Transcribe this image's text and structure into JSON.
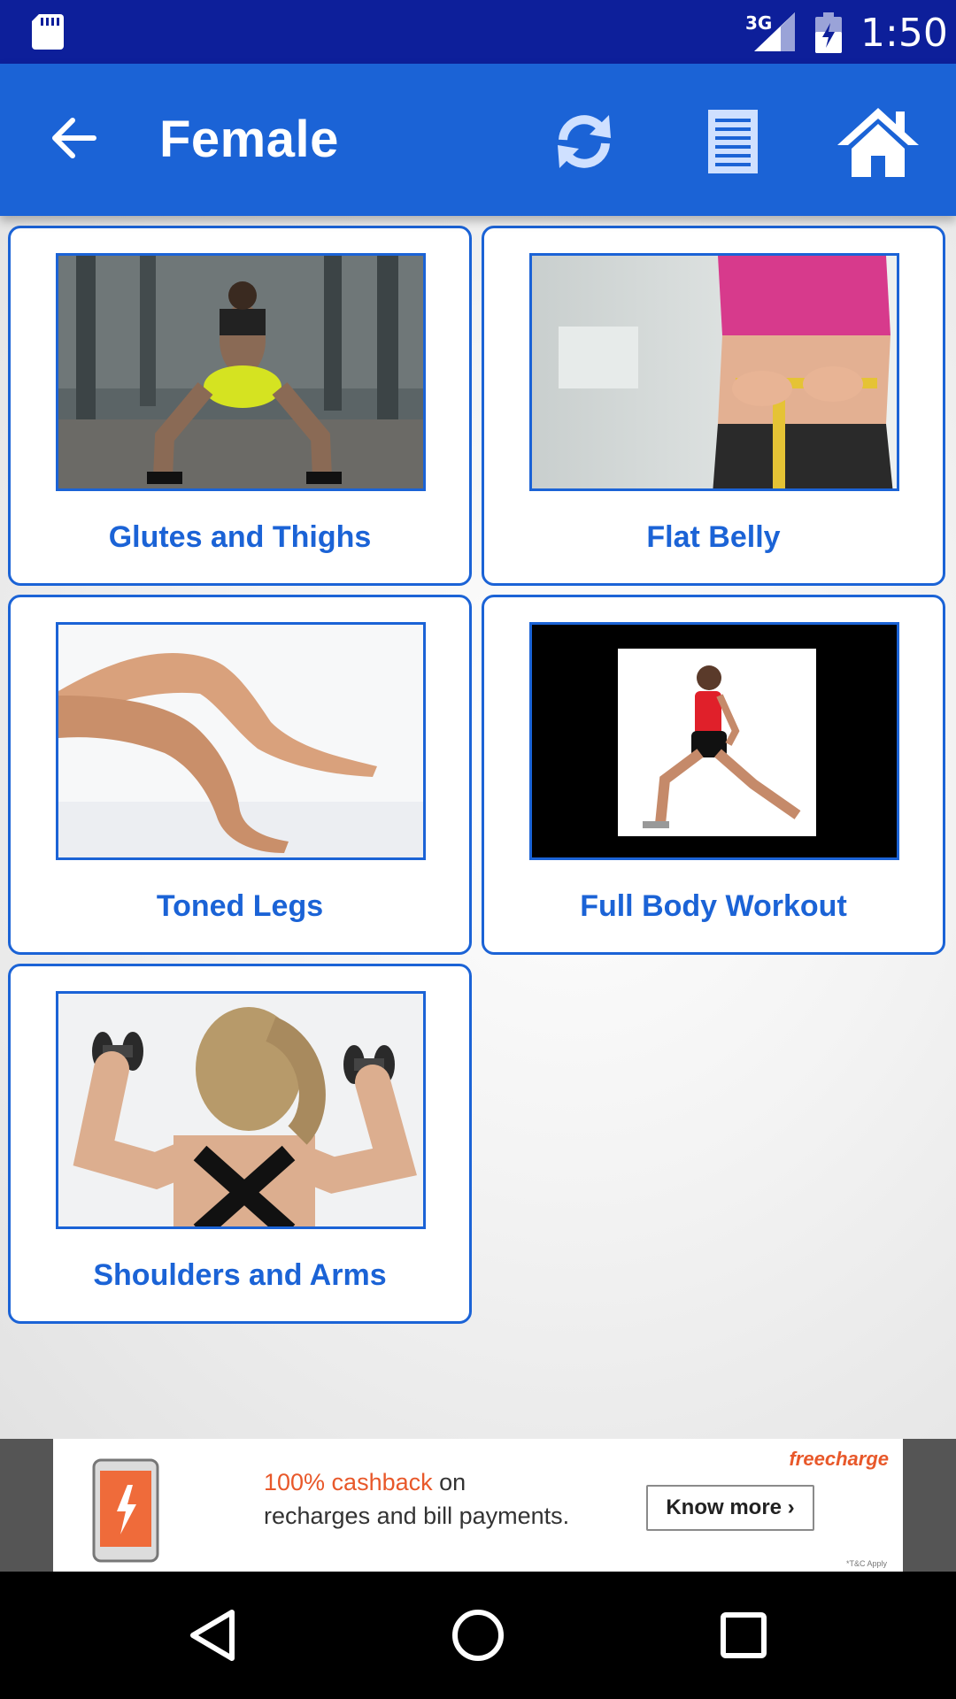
{
  "status_bar": {
    "network": "3G",
    "time": "1:50",
    "icons": [
      "sd-card-icon",
      "signal-icon",
      "battery-charging-icon"
    ]
  },
  "toolbar": {
    "title": "Female",
    "icons": [
      "back-arrow-icon",
      "refresh-icon",
      "list-icon",
      "home-icon"
    ],
    "color": "#1b63d6"
  },
  "categories": [
    {
      "label": "Glutes and Thighs",
      "image": "woman squatting in warehouse"
    },
    {
      "label": "Flat Belly",
      "image": "woman measuring waist with tape"
    },
    {
      "label": "Toned Legs",
      "image": "crossed female legs"
    },
    {
      "label": "Full Body Workout",
      "image": "woman in lunge stretch"
    },
    {
      "label": "Shoulders and Arms",
      "image": "woman lifting dumbbells"
    }
  ],
  "ad": {
    "brand": "freecharge",
    "highlight": "100% cashback",
    "line1_rest": " on",
    "line2": "recharges and bill payments.",
    "cta": "Know more ›",
    "fine_print": "*T&C Apply"
  },
  "nav_bar": {
    "icons": [
      "nav-back-icon",
      "nav-home-icon",
      "nav-recents-icon"
    ]
  }
}
